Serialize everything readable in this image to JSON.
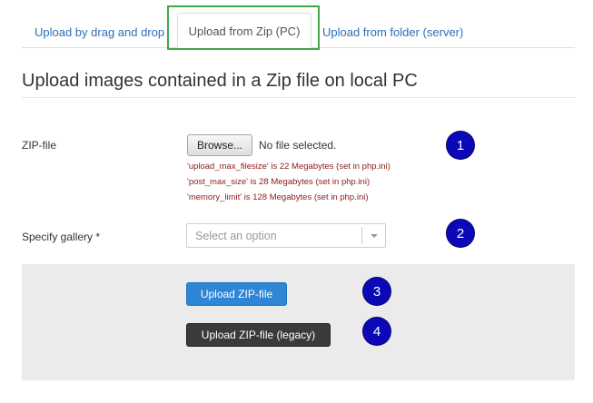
{
  "tabs": [
    {
      "label": "Upload by drag and drop"
    },
    {
      "label": "Upload from Zip (PC)"
    },
    {
      "label": "Upload from folder (server)"
    }
  ],
  "page_title": "Upload images contained in a Zip file on local PC",
  "zip_field": {
    "label": "ZIP-file",
    "browse_label": "Browse...",
    "status": "No file selected.",
    "limits": [
      "'upload_max_filesize' is 22 Megabytes (set in php.ini)",
      "'post_max_size' is 28 Megabytes (set in php.ini)",
      "'memory_limit' is 128 Megabytes (set in php.ini)"
    ]
  },
  "gallery_field": {
    "label": "Specify gallery *",
    "placeholder": "Select an option",
    "icon": "chevron-down-icon"
  },
  "actions": {
    "upload_label": "Upload ZIP-file",
    "upload_legacy_label": "Upload ZIP-file (legacy)"
  },
  "badges": [
    "1",
    "2",
    "3",
    "4"
  ],
  "colors": {
    "link": "#2a6ebb",
    "highlight_border": "#3fa84a",
    "limit_text": "#8b1a1a",
    "primary_button": "#2f86d6",
    "legacy_button": "#3a3a3a",
    "badge": "#0b08b8",
    "panel": "#ebebeb"
  }
}
